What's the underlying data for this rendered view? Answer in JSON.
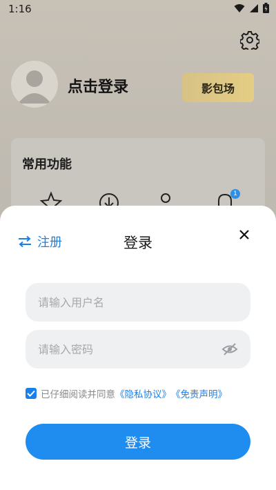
{
  "status_bar": {
    "time": "1:16"
  },
  "profile": {
    "login_prompt": "点击登录",
    "vip_button": "影包场",
    "common_functions_title": "常用功能",
    "notification_badge": "1"
  },
  "login_sheet": {
    "register_label": "注册",
    "title": "登录",
    "username_placeholder": "请输入用户名",
    "password_placeholder": "请输入密码",
    "agree_text": "已仔细阅读并同意",
    "privacy_link": "《隐私协议》",
    "disclaimer_link": "《免责声明》",
    "login_button": "登录",
    "agree_checked": true
  },
  "colors": {
    "accent": "#1f8cf0",
    "link": "#1a7fe6",
    "field_bg": "#eef0f2"
  }
}
